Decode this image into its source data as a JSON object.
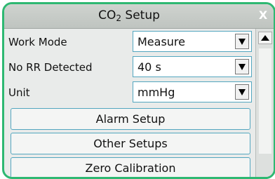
{
  "dialog": {
    "title_main": "CO",
    "title_sub": "2",
    "title_rest": " Setup",
    "close_label": "X"
  },
  "settings": [
    {
      "label": "Work Mode",
      "value": "Measure"
    },
    {
      "label": "No RR Detected",
      "value": "40 s"
    },
    {
      "label": "Unit",
      "value": "mmHg"
    }
  ],
  "buttons": [
    {
      "label": "Alarm Setup"
    },
    {
      "label": "Other Setups"
    },
    {
      "label": "Zero Calibration"
    }
  ],
  "colors": {
    "frame_border": "#2eb872",
    "field_border": "#53a6bf",
    "title_bg": "#c7ccc8"
  }
}
